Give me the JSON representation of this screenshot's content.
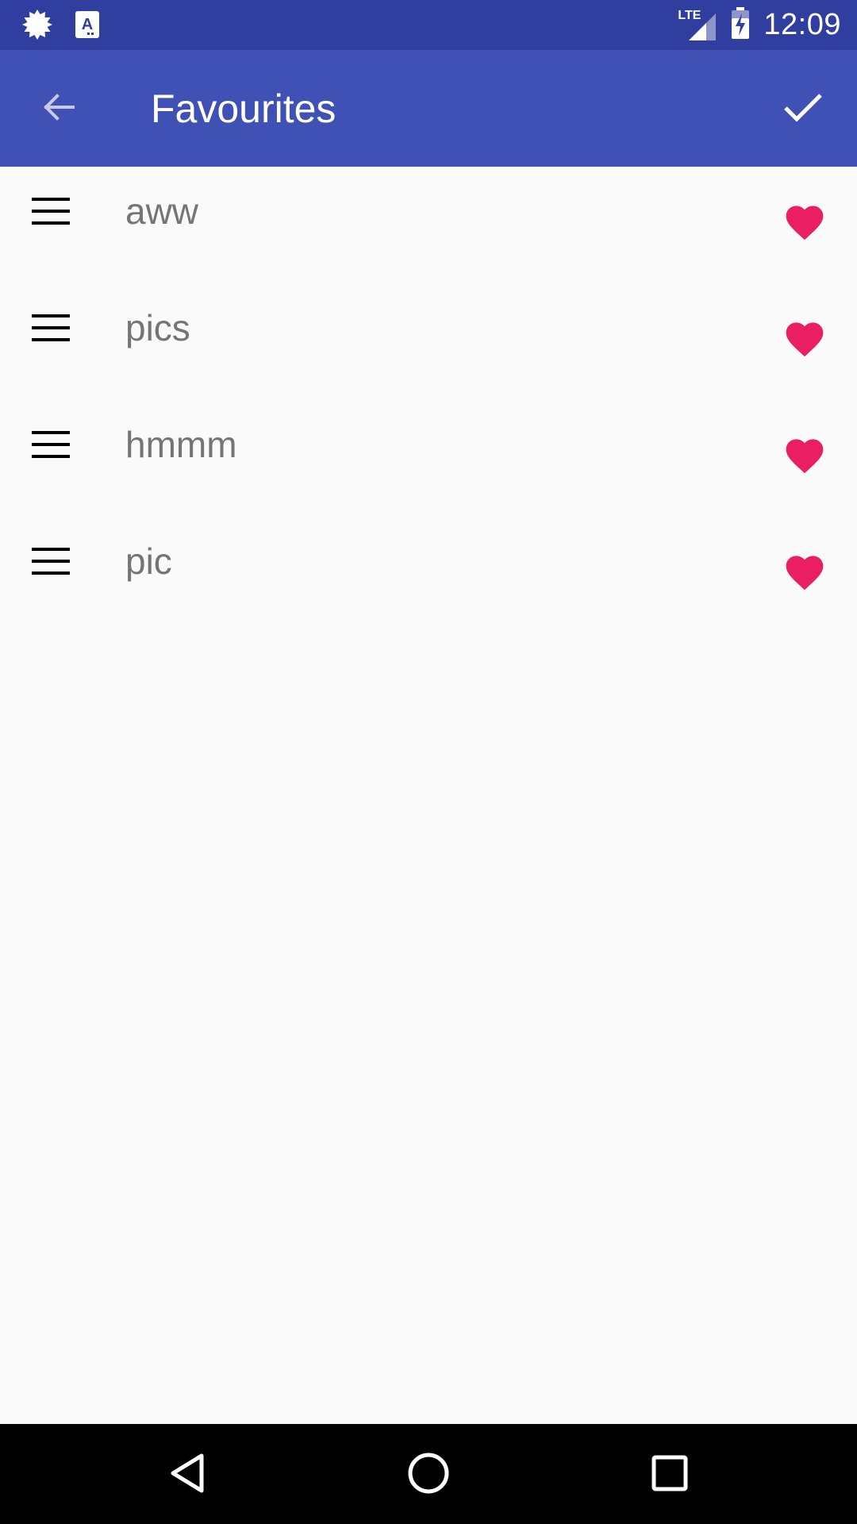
{
  "status_bar": {
    "network": "LTE",
    "time": "12:09",
    "left_icons": [
      "settings-burst-icon",
      "text-a-icon"
    ],
    "right_icons": [
      "signal-icon",
      "battery-charging-icon"
    ]
  },
  "app_bar": {
    "title": "Favourites",
    "back_icon": "arrow-back-icon",
    "confirm_icon": "check-icon",
    "color": "#3f51b5"
  },
  "list": {
    "items": [
      {
        "label": "aww",
        "favourite": true
      },
      {
        "label": "pics",
        "favourite": true
      },
      {
        "label": "hmmm",
        "favourite": true
      },
      {
        "label": "pic",
        "favourite": true
      }
    ],
    "handle_icon": "drag-handle-icon",
    "favourite_icon": "heart-icon",
    "favourite_color": "#e91e63"
  },
  "nav_bar": {
    "buttons": [
      "back-triangle-icon",
      "home-circle-icon",
      "recents-square-icon"
    ]
  }
}
